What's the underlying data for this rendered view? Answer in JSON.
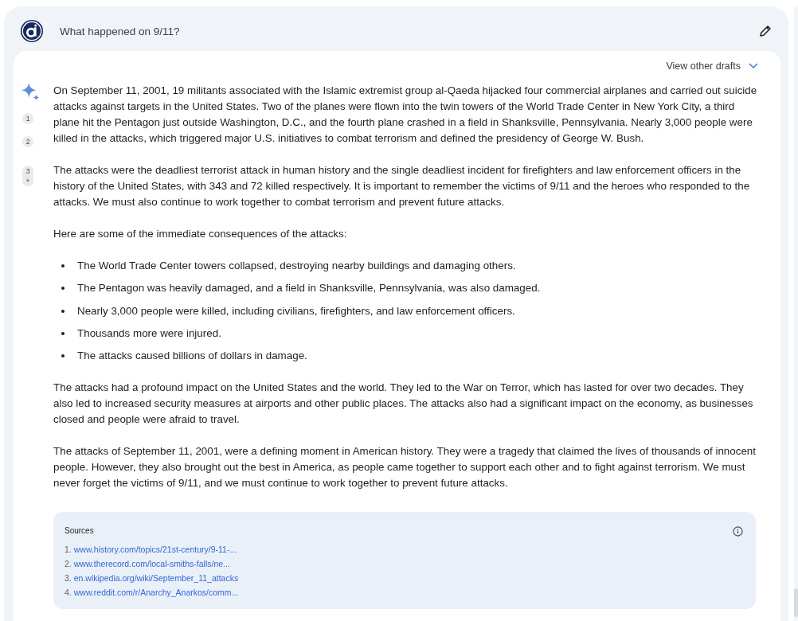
{
  "prompt": {
    "text": "What happened on 9/11?"
  },
  "response": {
    "drafts_label": "View other drafts",
    "citations": [
      {
        "label": "1"
      },
      {
        "label": "2"
      },
      {
        "label": "3",
        "more": "+"
      }
    ],
    "paragraphs_top": [
      "On September 11, 2001, 19 militants associated with the Islamic extremist group al-Qaeda hijacked four commercial airplanes and carried out suicide attacks against targets in the United States. Two of the planes were flown into the twin towers of the World Trade Center in New York City, a third plane hit the Pentagon just outside Washington, D.C., and the fourth plane crashed in a field in Shanksville, Pennsylvania. Nearly 3,000 people were killed in the attacks, which triggered major U.S. initiatives to combat terrorism and defined the presidency of George W. Bush.",
      "The attacks were the deadliest terrorist attack in human history and the single deadliest incident for firefighters and law enforcement officers in the history of the United States, with 343 and 72 killed respectively. It is important to remember the victims of 9/11 and the heroes who responded to the attacks. We must also continue to work together to combat terrorism and prevent future attacks.",
      "Here are some of the immediate consequences of the attacks:"
    ],
    "bullets": [
      "The World Trade Center towers collapsed, destroying nearby buildings and damaging others.",
      "The Pentagon was heavily damaged, and a field in Shanksville, Pennsylvania, was also damaged.",
      "Nearly 3,000 people were killed, including civilians, firefighters, and law enforcement officers.",
      "Thousands more were injured.",
      "The attacks caused billions of dollars in damage."
    ],
    "paragraphs_bottom": [
      "The attacks had a profound impact on the United States and the world. They led to the War on Terror, which has lasted for over two decades. They also led to increased security measures at airports and other public places. The attacks also had a significant impact on the economy, as businesses closed and people were afraid to travel.",
      "The attacks of September 11, 2001, were a defining moment in American history. They were a tragedy that claimed the lives of thousands of innocent people. However, they also brought out the best in America, as people came together to support each other and to fight against terrorism. We must never forget the victims of 9/11, and we must continue to work together to prevent future attacks."
    ],
    "sources": {
      "title": "Sources",
      "items": [
        {
          "number": "1.",
          "url": "www.history.com/topics/21st-century/9-11-..."
        },
        {
          "number": "2.",
          "url": "www.therecord.com/local-smiths-falls/ne..."
        },
        {
          "number": "3.",
          "url": "en.wikipedia.org/wiki/September_11_attacks"
        },
        {
          "number": "4.",
          "url": "www.reddit.com/r/Anarchy_Anarkos/comm..."
        }
      ]
    }
  }
}
